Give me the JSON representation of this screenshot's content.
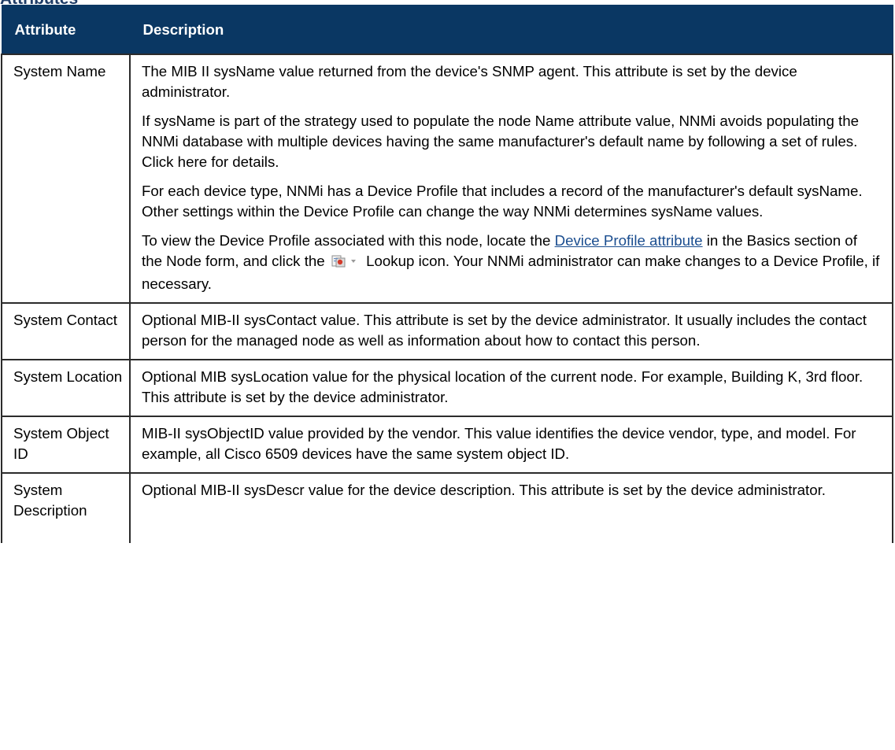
{
  "section_heading": "Attributes",
  "table": {
    "headers": {
      "attribute": "Attribute",
      "description": "Description"
    },
    "rows": [
      {
        "name": "System Name",
        "p1": "The MIB II sysName value returned from the device's SNMP agent. This attribute is set by the device administrator.",
        "p2": "If sysName is part of the strategy used to populate the node Name attribute value, NNMi avoids populating the NNMi database with multiple devices having the same manufacturer's default name by following a set of rules. Click here for details.",
        "p3": "For each device type, NNMi has a Device Profile that includes a record of the manufacturer's default sysName. Other settings within the Device Profile can change the way NNMi determines sysName values.",
        "p4_before": "To view the Device Profile associated with this node, locate the ",
        "p4_link": "Device Profile attribute",
        "p4_middle": " in the Basics section of the Node form, and click the ",
        "p4_icon": "lookup-icon",
        "p4_after": " Lookup icon. Your NNMi administrator can make changes to a Device Profile, if necessary."
      },
      {
        "name": "System Contact",
        "description": "Optional MIB-II sysContact value. This attribute is set by the device administrator. It usually includes the contact person for the managed node as well as information about how to contact this person."
      },
      {
        "name": "System Location",
        "description": "Optional MIB sysLocation value for the physical location of the current node. For example, Building K, 3rd floor. This attribute is set by the device administrator."
      },
      {
        "name": "System Object ID",
        "description": "MIB-II sysObjectID value provided by the vendor. This value identifies the device vendor, type, and model. For example, all Cisco 6509 devices have the same system object ID."
      },
      {
        "name": "System Description",
        "description": "Optional MIB-II sysDescr value for the device description. This attribute is set by the device administrator."
      }
    ]
  },
  "colors": {
    "header_bg": "#0a3763",
    "header_text": "#ffffff",
    "link": "#1a4d8f",
    "border": "#2b2b2b"
  }
}
